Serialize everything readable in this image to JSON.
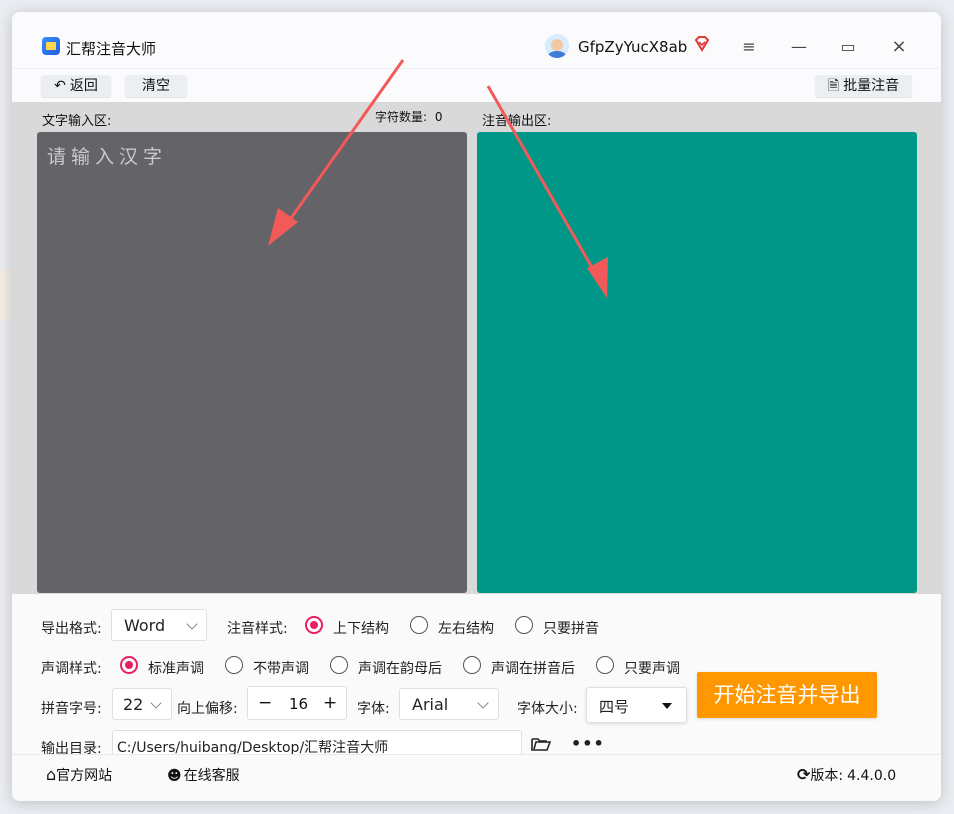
{
  "app": {
    "title": "汇帮注音大师",
    "username": "GfpZyYucX8ab"
  },
  "window_controls": {
    "menu": "≡",
    "minimize": "—",
    "maximize": "▭",
    "close": "×"
  },
  "toolbar": {
    "back_label": "返回",
    "clear_label": "清空",
    "batch_label": "批量注音"
  },
  "input_panel": {
    "label": "文字输入区:",
    "char_count_label": "字符数量:",
    "char_count": "0",
    "placeholder": "请输入汉字"
  },
  "output_panel": {
    "label": "注音输出区:"
  },
  "settings": {
    "export_format": {
      "label": "导出格式:",
      "value": "Word"
    },
    "annotation_style": {
      "label": "注音样式:",
      "options": [
        "上下结构",
        "左右结构",
        "只要拼音"
      ],
      "selected": "上下结构"
    },
    "tone_style": {
      "label": "声调样式:",
      "options": [
        "标准声调",
        "不带声调",
        "声调在韵母后",
        "声调在拼音后",
        "只要声调"
      ],
      "selected": "标准声调"
    },
    "pinyin_size": {
      "label": "拼音字号:",
      "value": "22"
    },
    "offset": {
      "label": "向上偏移:",
      "value": "16",
      "minus": "−",
      "plus": "+"
    },
    "font": {
      "label": "字体:",
      "value": "Arial"
    },
    "font_size": {
      "label": "字体大小:",
      "value": "四号"
    },
    "output_dir": {
      "label": "输出目录:",
      "value": "C:/Users/huibang/Desktop/汇帮注音大师"
    },
    "start_button": "开始注音并导出"
  },
  "footer": {
    "website": "官方网站",
    "support": "在线客服",
    "version_label": "版本:",
    "version": "4.4.0.0"
  },
  "colors": {
    "input_bg": "#636368",
    "output_bg": "#009688",
    "accent_radio": "#e91e63",
    "start_button": "#ff9800",
    "annotation_arrow": "#f25a5a"
  }
}
